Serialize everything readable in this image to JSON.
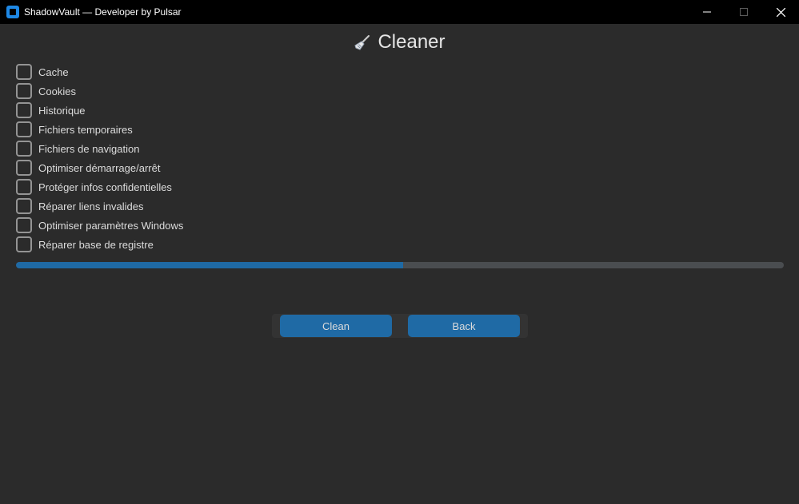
{
  "window": {
    "title": "ShadowVault — Developer by Pulsar",
    "app_icon": "app-icon",
    "controls": [
      "minimize-icon",
      "maximize-icon",
      "close-icon"
    ]
  },
  "header": {
    "icon": "broom-icon",
    "title": "Cleaner"
  },
  "options": [
    {
      "label": "Cache",
      "checked": false
    },
    {
      "label": "Cookies",
      "checked": false
    },
    {
      "label": "Historique",
      "checked": false
    },
    {
      "label": "Fichiers temporaires",
      "checked": false
    },
    {
      "label": "Fichiers de navigation",
      "checked": false
    },
    {
      "label": "Optimiser démarrage/arrêt",
      "checked": false
    },
    {
      "label": "Protéger infos confidentielles",
      "checked": false
    },
    {
      "label": "Réparer liens invalides",
      "checked": false
    },
    {
      "label": "Optimiser paramètres Windows",
      "checked": false
    },
    {
      "label": "Réparer base de registre",
      "checked": false
    }
  ],
  "progress": {
    "value_percent": 50.4
  },
  "buttons": {
    "clean_label": "Clean",
    "back_label": "Back"
  },
  "colors": {
    "accent": "#1f6aa5",
    "background": "#2b2b2b",
    "titlebar": "#000000",
    "checkbox_border": "#949494",
    "progress_track": "#4a4d50"
  }
}
